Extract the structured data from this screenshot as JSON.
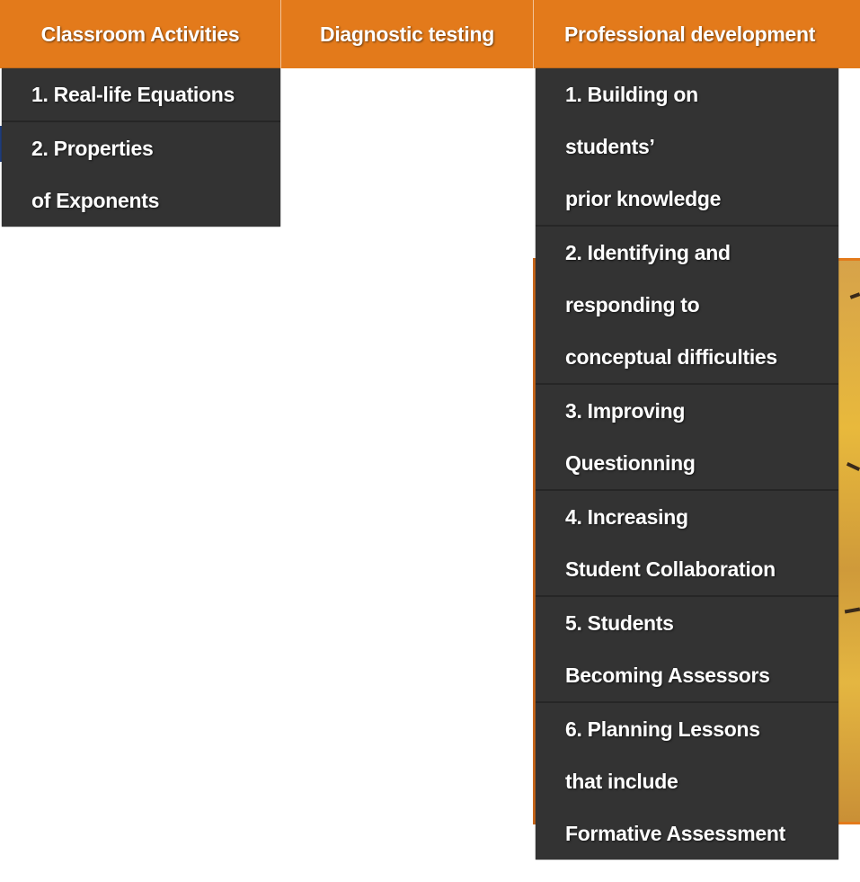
{
  "nav": {
    "classroom_activities": "Classroom Activities",
    "diagnostic_testing": "Diagnostic testing",
    "professional_development": "Professional development"
  },
  "classroom_menu": {
    "items": [
      {
        "lines": [
          "1. Real-life Equations"
        ]
      },
      {
        "lines": [
          "2. Properties",
          "of Exponents"
        ]
      }
    ]
  },
  "professional_menu": {
    "items": [
      {
        "lines": [
          "1. Building on",
          "students’",
          "prior knowledge"
        ]
      },
      {
        "lines": [
          "2. Identifying and",
          "responding to",
          "conceptual difficulties"
        ]
      },
      {
        "lines": [
          "3. Improving",
          "Questionning"
        ]
      },
      {
        "lines": [
          "4. Increasing",
          "Student Collaboration"
        ]
      },
      {
        "lines": [
          "5. Students",
          "Becoming Assessors"
        ]
      },
      {
        "lines": [
          "6. Planning Lessons",
          "that include",
          "Formative Assessment"
        ]
      }
    ]
  },
  "colors": {
    "nav_bar": "#e37a1b",
    "menu_background": "#333333",
    "menu_text": "#ffffff"
  }
}
